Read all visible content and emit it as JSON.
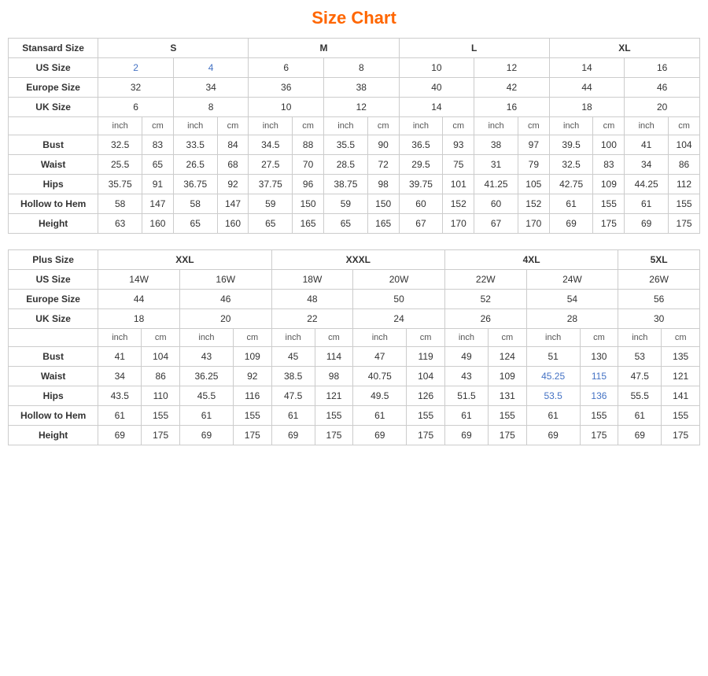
{
  "title": "Size Chart",
  "standard": {
    "header": "Stansard Size",
    "size_groups": [
      "S",
      "M",
      "L",
      "XL"
    ],
    "us_label": "US Size",
    "eu_label": "Europe Size",
    "uk_label": "UK Size",
    "us_sizes": [
      "2",
      "4",
      "6",
      "8",
      "10",
      "12",
      "14",
      "16"
    ],
    "eu_sizes": [
      "32",
      "34",
      "36",
      "38",
      "40",
      "42",
      "44",
      "46"
    ],
    "uk_sizes": [
      "6",
      "8",
      "10",
      "12",
      "14",
      "16",
      "18",
      "20"
    ],
    "measurements": [
      {
        "label": "Bust",
        "values": [
          "32.5",
          "83",
          "33.5",
          "84",
          "34.5",
          "88",
          "35.5",
          "90",
          "36.5",
          "93",
          "38",
          "97",
          "39.5",
          "100",
          "41",
          "104"
        ]
      },
      {
        "label": "Waist",
        "values": [
          "25.5",
          "65",
          "26.5",
          "68",
          "27.5",
          "70",
          "28.5",
          "72",
          "29.5",
          "75",
          "31",
          "79",
          "32.5",
          "83",
          "34",
          "86"
        ]
      },
      {
        "label": "Hips",
        "values": [
          "35.75",
          "91",
          "36.75",
          "92",
          "37.75",
          "96",
          "38.75",
          "98",
          "39.75",
          "101",
          "41.25",
          "105",
          "42.75",
          "109",
          "44.25",
          "112"
        ]
      },
      {
        "label": "Hollow to Hem",
        "values": [
          "58",
          "147",
          "58",
          "147",
          "59",
          "150",
          "59",
          "150",
          "60",
          "152",
          "60",
          "152",
          "61",
          "155",
          "61",
          "155"
        ]
      },
      {
        "label": "Height",
        "values": [
          "63",
          "160",
          "65",
          "160",
          "65",
          "165",
          "65",
          "165",
          "67",
          "170",
          "67",
          "170",
          "69",
          "175",
          "69",
          "175"
        ]
      }
    ]
  },
  "plus": {
    "header": "Plus Size",
    "size_groups": [
      "XXL",
      "XXXL",
      "4XL",
      "5XL"
    ],
    "us_label": "US Size",
    "eu_label": "Europe Size",
    "uk_label": "UK Size",
    "us_sizes": [
      "14W",
      "16W",
      "18W",
      "20W",
      "22W",
      "24W",
      "26W"
    ],
    "eu_sizes": [
      "44",
      "46",
      "48",
      "50",
      "52",
      "54",
      "56"
    ],
    "uk_sizes": [
      "18",
      "20",
      "22",
      "24",
      "26",
      "28",
      "30"
    ],
    "measurements": [
      {
        "label": "Bust",
        "values": [
          "41",
          "104",
          "43",
          "109",
          "45",
          "114",
          "47",
          "119",
          "49",
          "124",
          "51",
          "130",
          "53",
          "135"
        ]
      },
      {
        "label": "Waist",
        "values": [
          "34",
          "86",
          "36.25",
          "92",
          "38.5",
          "98",
          "40.75",
          "104",
          "43",
          "109",
          "45.25",
          "115",
          "47.5",
          "121"
        ]
      },
      {
        "label": "Hips",
        "values": [
          "43.5",
          "110",
          "45.5",
          "116",
          "47.5",
          "121",
          "49.5",
          "126",
          "51.5",
          "131",
          "53.5",
          "136",
          "55.5",
          "141"
        ]
      },
      {
        "label": "Hollow to Hem",
        "values": [
          "61",
          "155",
          "61",
          "155",
          "61",
          "155",
          "61",
          "155",
          "61",
          "155",
          "61",
          "155",
          "61",
          "155"
        ]
      },
      {
        "label": "Height",
        "values": [
          "69",
          "175",
          "69",
          "175",
          "69",
          "175",
          "69",
          "175",
          "69",
          "175",
          "69",
          "175",
          "69",
          "175"
        ]
      }
    ]
  }
}
